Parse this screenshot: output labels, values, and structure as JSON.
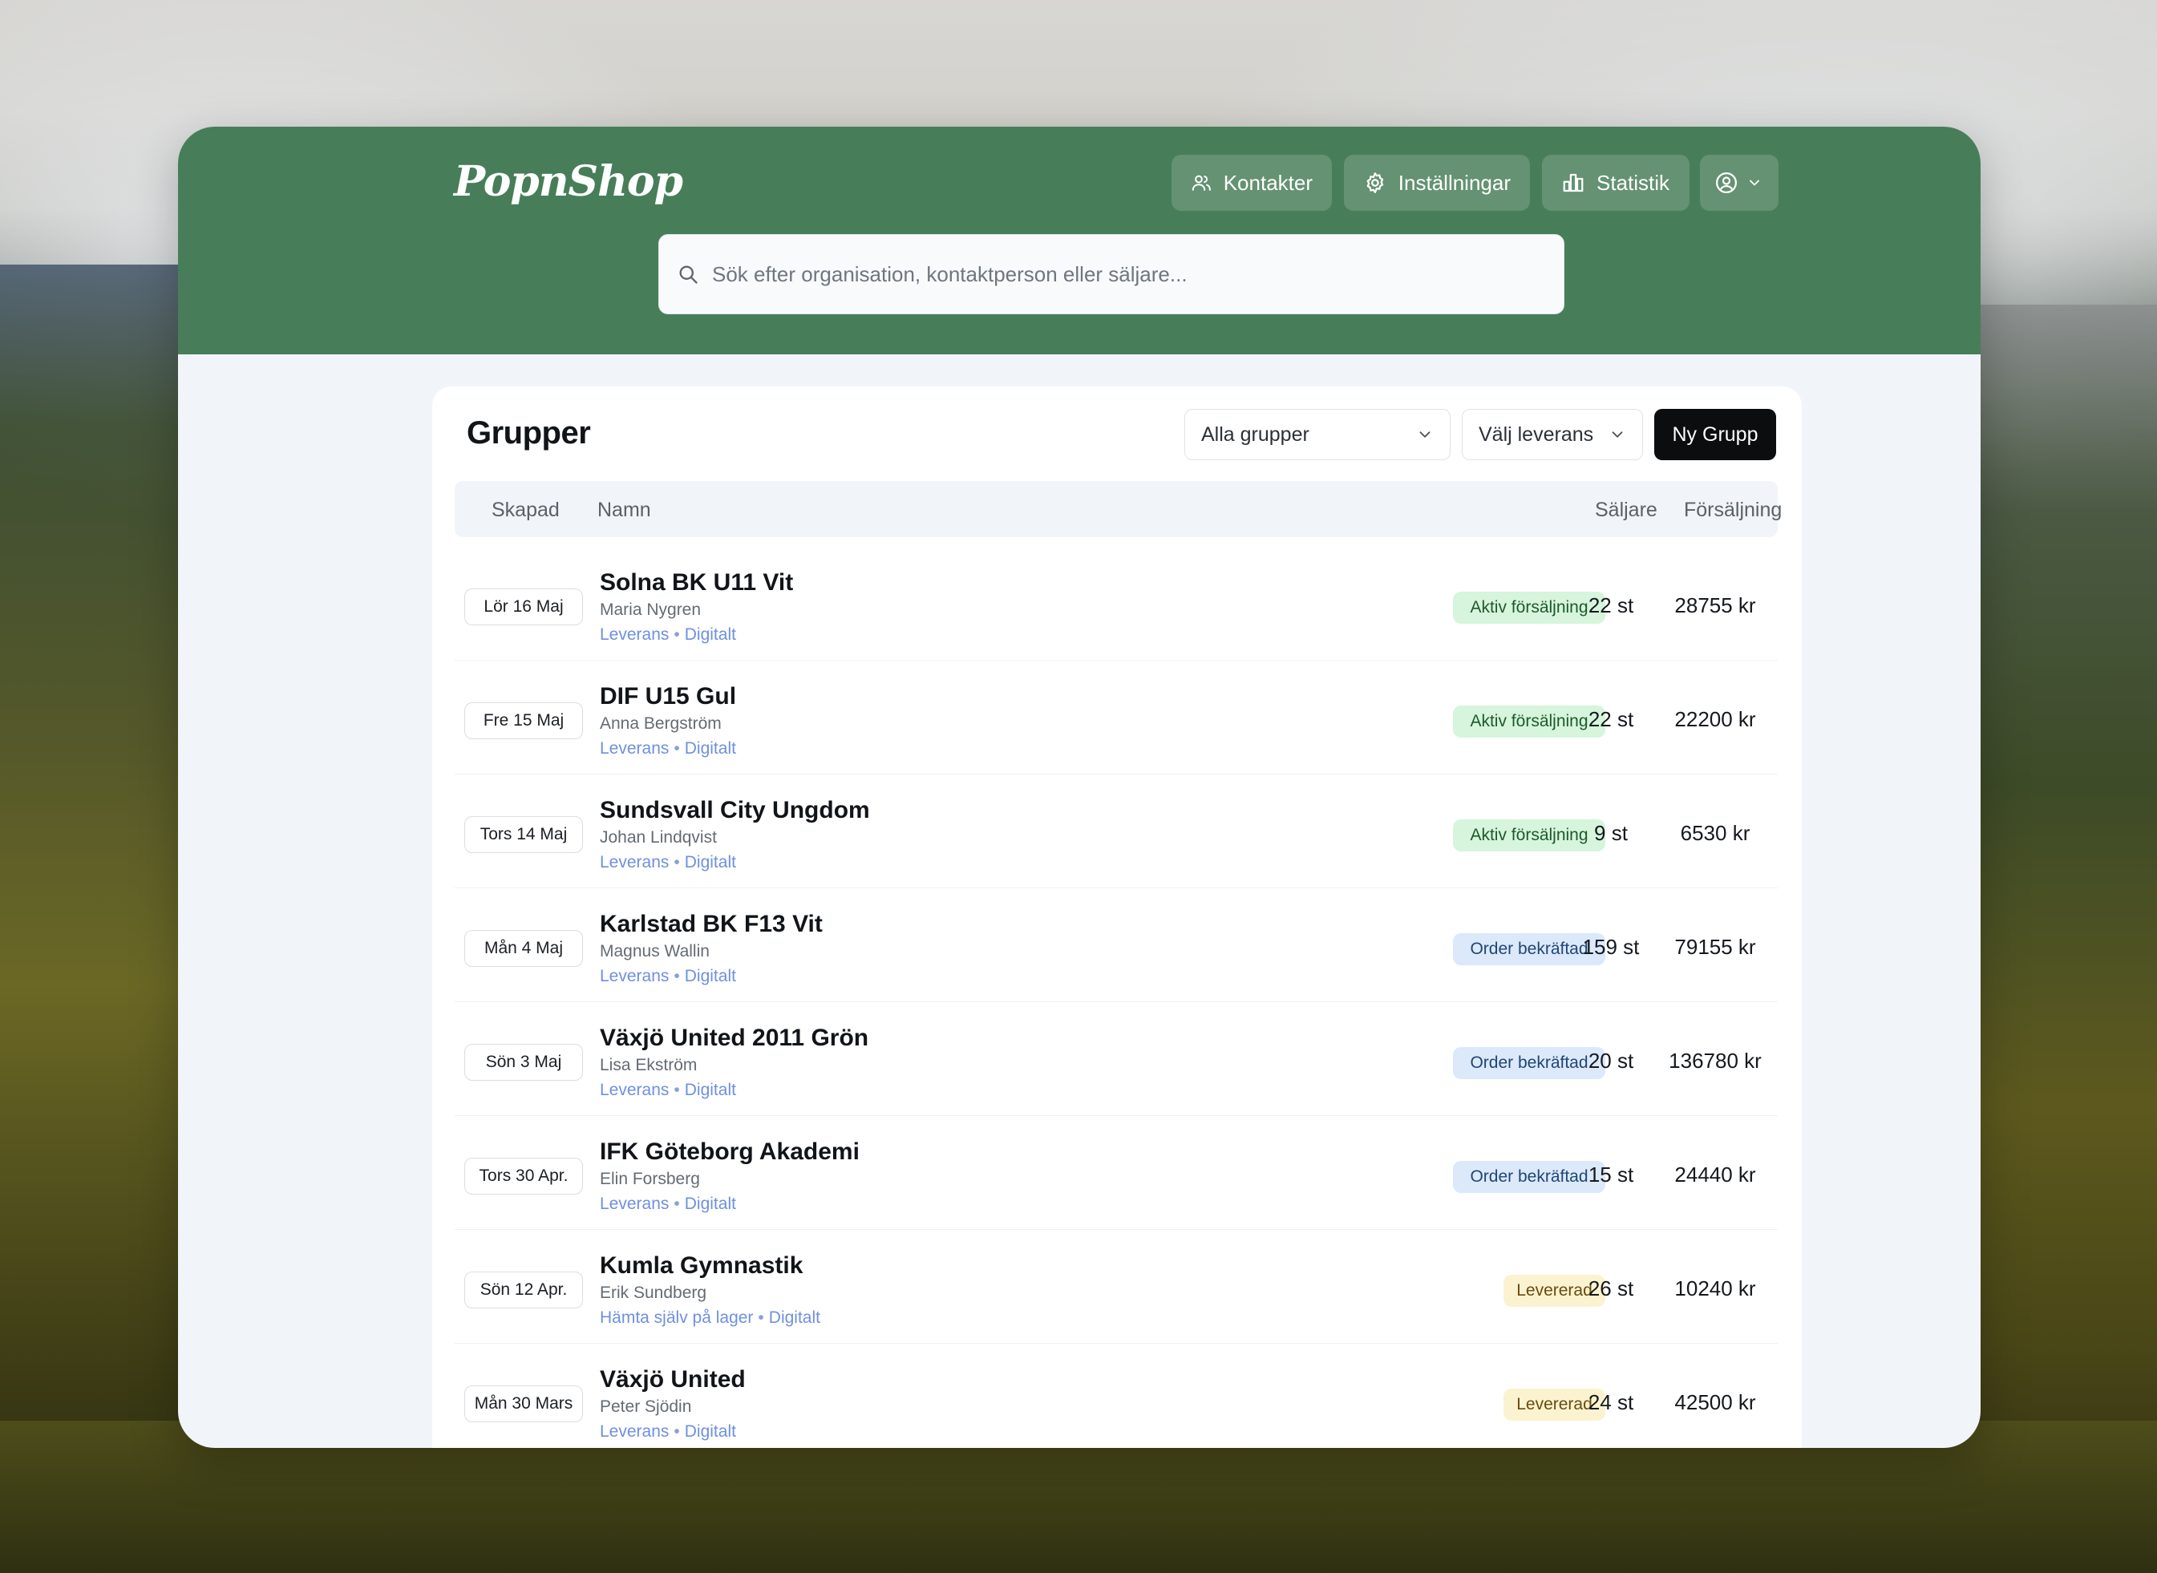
{
  "app": {
    "logo": "PopnShop"
  },
  "nav": {
    "contacts": "Kontakter",
    "settings": "Inställningar",
    "stats": "Statistik"
  },
  "search": {
    "placeholder": "Sök efter organisation, kontaktperson eller säljare..."
  },
  "groups": {
    "title": "Grupper",
    "filter_groups": "Alla grupper",
    "filter_delivery": "Välj leverans",
    "new_button": "Ny Grupp",
    "columns": {
      "created": "Skapad",
      "name": "Namn",
      "sellers": "Säljare",
      "sales": "Försäljning"
    },
    "rows": [
      {
        "date": "Lör 16 Maj",
        "name": "Solna BK U11 Vit",
        "contact": "Maria Nygren",
        "delivery": "Leverans",
        "channel": "Digitalt",
        "status": "Aktiv försäljning",
        "sellers": "22 st",
        "sales": "28755 kr"
      },
      {
        "date": "Fre 15 Maj",
        "name": "DIF U15 Gul",
        "contact": "Anna Bergström",
        "delivery": "Leverans",
        "channel": "Digitalt",
        "status": "Aktiv försäljning",
        "sellers": "22 st",
        "sales": "22200 kr"
      },
      {
        "date": "Tors 14 Maj",
        "name": "Sundsvall City Ungdom",
        "contact": "Johan Lindqvist",
        "delivery": "Leverans",
        "channel": "Digitalt",
        "status": "Aktiv försäljning",
        "sellers": "9 st",
        "sales": "6530 kr"
      },
      {
        "date": "Mån 4 Maj",
        "name": "Karlstad BK F13 Vit",
        "contact": "Magnus Wallin",
        "delivery": "Leverans",
        "channel": "Digitalt",
        "status": "Order bekräftad",
        "sellers": "159 st",
        "sales": "79155 kr"
      },
      {
        "date": "Sön 3 Maj",
        "name": "Växjö United 2011 Grön",
        "contact": "Lisa Ekström",
        "delivery": "Leverans",
        "channel": "Digitalt",
        "status": "Order bekräftad",
        "sellers": "20 st",
        "sales": "136780 kr"
      },
      {
        "date": "Tors 30 Apr.",
        "name": "IFK Göteborg Akademi",
        "contact": "Elin Forsberg",
        "delivery": "Leverans",
        "channel": "Digitalt",
        "status": "Order bekräftad",
        "sellers": "15 st",
        "sales": "24440 kr"
      },
      {
        "date": "Sön 12 Apr.",
        "name": "Kumla Gymnastik",
        "contact": "Erik Sundberg",
        "delivery": "Hämta själv på lager",
        "channel": "Digitalt",
        "status": "Levererad",
        "sellers": "26 st",
        "sales": "10240 kr"
      },
      {
        "date": "Mån 30 Mars",
        "name": "Växjö United",
        "contact": "Peter Sjödin",
        "delivery": "Leverans",
        "channel": "Digitalt",
        "status": "Levererad",
        "sellers": "24 st",
        "sales": "42500 kr"
      }
    ]
  },
  "colors": {
    "header": "#477e59",
    "status_active": "#d6f5dc",
    "status_confirmed": "#dbe9fb",
    "status_delivered": "#fbf3cf",
    "tag_link": "#6f8fe0"
  },
  "icons": {
    "contacts": "users-icon",
    "settings": "gear-icon",
    "stats": "bar-chart-icon",
    "account": "user-circle-icon",
    "search": "search-icon"
  }
}
